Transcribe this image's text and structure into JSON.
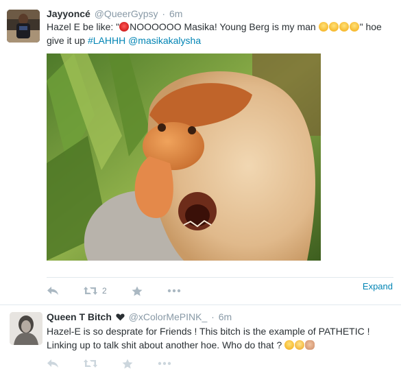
{
  "tweets": [
    {
      "fullname": "Jayyoncé",
      "username": "@QueerGypsy",
      "separator": "·",
      "time": "6m",
      "text_before": "Hazel E be like: \"",
      "text_main": "NOOOOOO Masika! Young Berg is my man ",
      "text_after": "\" hoe give it up ",
      "hashtag": "#LAHHH",
      "mention": "@masikakalysha",
      "emojis_after_text": [
        "face-with-tears-of-joy",
        "face-with-tears-of-joy",
        "face-with-tears-of-joy",
        "face-with-tears-of-joy"
      ],
      "emoji_before_text": "angry-face",
      "has_media": true,
      "retweet_count": "2",
      "expand_label": "Expand"
    },
    {
      "fullname": "Queen T Bitch",
      "name_icon": "heart",
      "username": "@xColorMePINK_",
      "separator": "·",
      "time": "6m",
      "text_line1": "Hazel-E is so desprate for Friends ! This bitch is the example of PATHETIC !",
      "text_line2": "Linking up to talk shit about another hoe. Who do that ? ",
      "emojis": [
        "face-with-tears-of-joy",
        "astonished-face",
        "raised-hand"
      ],
      "has_media": false
    }
  ],
  "colors": {
    "link": "#0084b4",
    "muted": "#8899a6",
    "text": "#292f33",
    "divider": "#e1e8ed"
  }
}
